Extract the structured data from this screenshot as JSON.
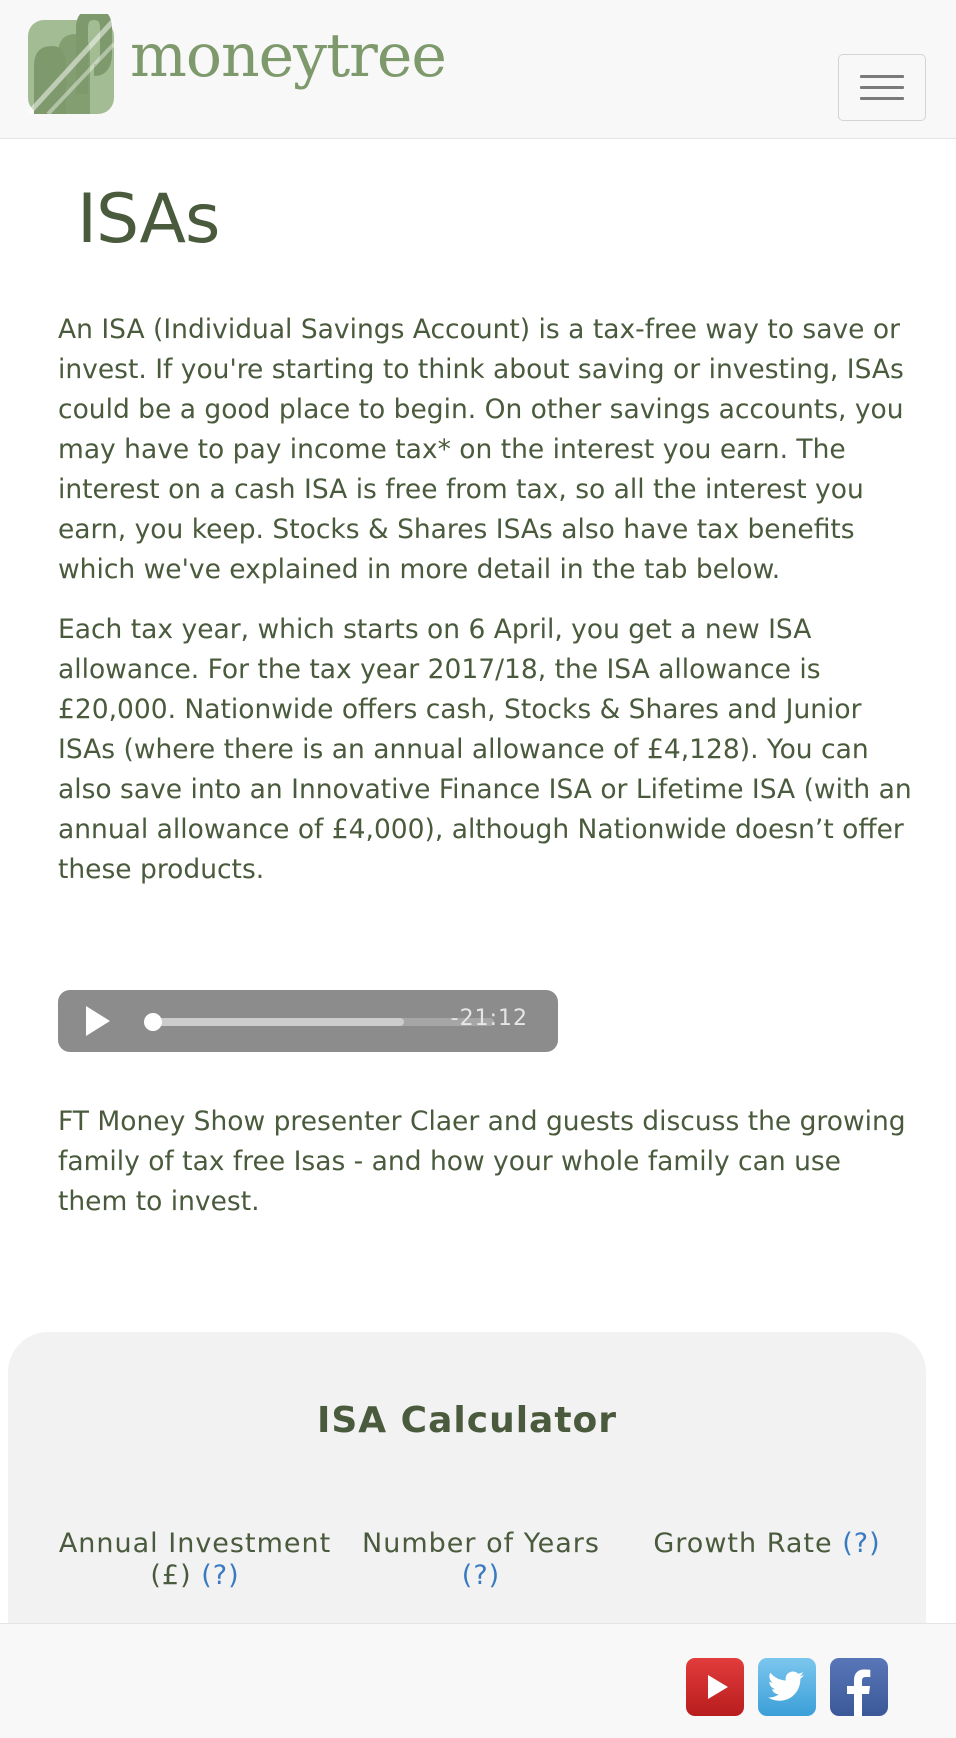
{
  "header": {
    "brand_name": "moneytree",
    "logo_icon": "moneytree-logo-icon",
    "menu_icon": "hamburger-menu-icon"
  },
  "main": {
    "title": "ISAs",
    "paragraph_1": "An ISA (Individual Savings Account) is a tax-free way to save or invest. If you're starting to think about saving or investing, ISAs could be a good place to begin. On other savings accounts, you may have to pay income tax* on the interest you earn. The interest on a cash ISA is free from tax, so all the interest you earn, you keep. Stocks & Shares ISAs also have tax benefits which we've explained in more detail in the tab below.",
    "paragraph_2": "Each tax year, which starts on 6 April, you get a new ISA allowance. For the tax year 2017/18, the ISA allowance is £20,000. Nationwide offers cash, Stocks & Shares and Junior ISAs (where there is an annual allowance of £4,128). You can also save into an Innovative Finance ISA or Lifetime ISA (with an annual allowance of £4,000), although Nationwide doesn’t offer these products.",
    "audio": {
      "time_remaining": "-21:12",
      "playback_progress": 0.0,
      "buffered_fraction": 0.74,
      "play_icon": "play-icon"
    },
    "paragraph_3": "FT Money Show presenter Claer and guests discuss the growing family of tax free Isas - and how your whole family can use them to invest."
  },
  "calculator": {
    "title": "ISA Calculator",
    "help_label": "(?)",
    "columns": [
      {
        "label_line1": "Annual Investment",
        "label_line2": "(£)"
      },
      {
        "label_line1": "Number of Years",
        "label_line2": ""
      },
      {
        "label_line1": "Growth Rate",
        "label_line2": ""
      }
    ]
  },
  "footer": {
    "social_icons": [
      "youtube-icon",
      "twitter-icon",
      "facebook-icon"
    ]
  },
  "colors": {
    "brand_green": "#7e9a6c",
    "text": "#4a5a3c",
    "link_blue": "#3a7ac0",
    "audio_bg": "#8c8c8c",
    "calc_bg": "#f2f2f2"
  }
}
